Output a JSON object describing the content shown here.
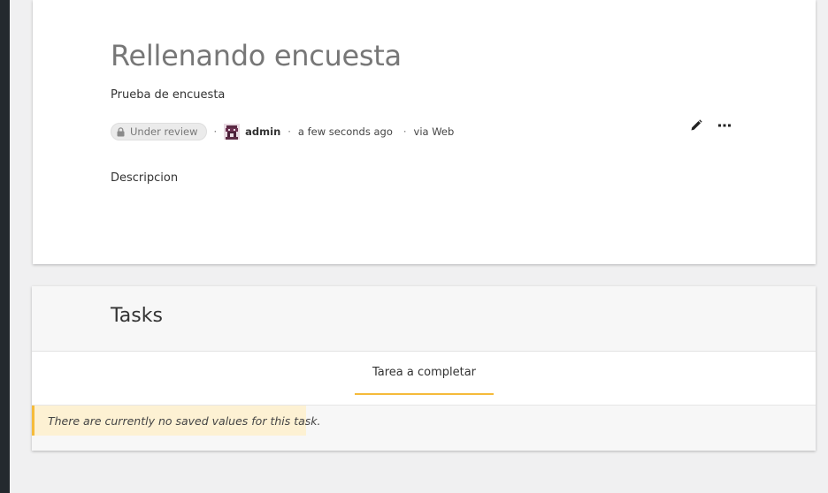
{
  "survey": {
    "title": "Rellenando encuesta",
    "subtitle": "Prueba de encuesta",
    "status_badge": "Under review",
    "author": "admin",
    "time": "a few seconds ago",
    "via": "via Web",
    "description": "Descripcion",
    "icons": {
      "badge": "lock-icon",
      "edit": "pencil-icon",
      "more": "more-horizontal-icon"
    }
  },
  "tasks": {
    "title": "Tasks",
    "tab_label": "Tarea a completar",
    "notice": "There are currently no saved values for this task."
  },
  "colors": {
    "accent": "#f5bb3b",
    "notice_bg": "#fdf1d3",
    "sidebar": "#24292e"
  }
}
